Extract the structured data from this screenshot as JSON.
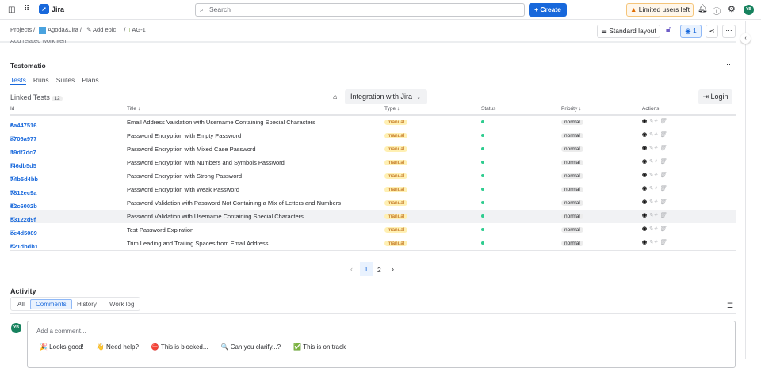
{
  "topbar": {
    "app_name": "Jira",
    "search_placeholder": "Search",
    "create_label": "+ Create",
    "limited_label": "Limited users left",
    "avatar": "YB"
  },
  "breadcrumb": {
    "projects": "Projects",
    "project": "Agoda&Jira",
    "add_epic": "Add epic",
    "issue": "AG-1"
  },
  "toolbar": {
    "layout_label": "Standard layout",
    "watchers": "1"
  },
  "cut_text": "Add related work item",
  "panel": {
    "title": "Testomatio",
    "tabs": [
      "Tests",
      "Runs",
      "Suites",
      "Plans"
    ],
    "active_tab": "Tests",
    "linked_label": "Linked Tests",
    "linked_count": "12",
    "integration_label": "Integration with Jira",
    "login_label": "Login",
    "columns": {
      "id": "Id",
      "title": "Title ↕",
      "type": "Type ↕",
      "status": "Status",
      "priority": "Priority ↕",
      "actions": "Actions"
    },
    "rows": [
      {
        "id": "6a447516",
        "title": "Email Address Validation with Username Containing Special Characters",
        "type": "manual",
        "priority": "normal"
      },
      {
        "id": "a706a977",
        "title": "Password Encryption with Empty Password",
        "type": "manual",
        "priority": "normal"
      },
      {
        "id": "19df7dc7",
        "title": "Password Encryption with Mixed Case Password",
        "type": "manual",
        "priority": "normal"
      },
      {
        "id": "f46db5d5",
        "title": "Password Encryption with Numbers and Symbols Password",
        "type": "manual",
        "priority": "normal"
      },
      {
        "id": "74b5d4bb",
        "title": "Password Encryption with Strong Password",
        "type": "manual",
        "priority": "normal"
      },
      {
        "id": "7812ec9a",
        "title": "Password Encryption with Weak Password",
        "type": "manual",
        "priority": "normal"
      },
      {
        "id": "62c6002b",
        "title": "Password Validation with Password Not Containing a Mix of Letters and Numbers",
        "type": "manual",
        "priority": "normal"
      },
      {
        "id": "53122d9f",
        "title": "Password Validation with Username Containing Special Characters",
        "type": "manual",
        "priority": "normal"
      },
      {
        "id": "ee4d5089",
        "title": "Test Password Expiration",
        "type": "manual",
        "priority": "normal"
      },
      {
        "id": "021dbdb1",
        "title": "Trim Leading and Trailing Spaces from Email Address",
        "type": "manual",
        "priority": "normal"
      }
    ],
    "pages": [
      "1",
      "2"
    ],
    "current_page": "1"
  },
  "activity": {
    "title": "Activity",
    "tabs": [
      "All",
      "Comments",
      "History",
      "Work log"
    ],
    "active_tab": "Comments",
    "comment_placeholder": "Add a comment...",
    "quick_replies": [
      "🎉 Looks good!",
      "👋 Need help?",
      "⛔ This is blocked...",
      "🔍 Can you clarify...?",
      "✅ This is on track"
    ]
  }
}
